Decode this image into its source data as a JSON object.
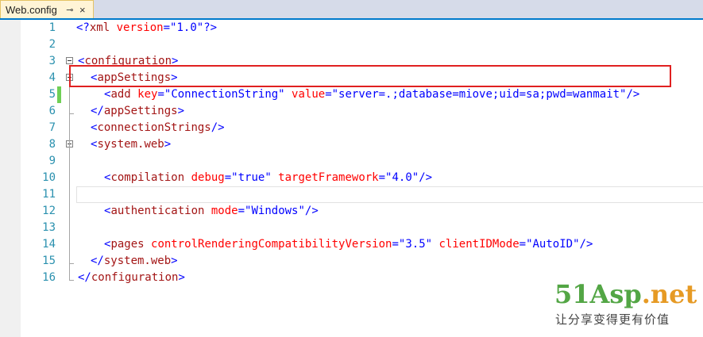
{
  "tab": {
    "title": "Web.config",
    "pin_glyph": "⊸",
    "close_glyph": "×"
  },
  "lines": [
    {
      "num": "1"
    },
    {
      "num": "2"
    },
    {
      "num": "3"
    },
    {
      "num": "4"
    },
    {
      "num": "5"
    },
    {
      "num": "6"
    },
    {
      "num": "7"
    },
    {
      "num": "8"
    },
    {
      "num": "9"
    },
    {
      "num": "10"
    },
    {
      "num": "11"
    },
    {
      "num": "12"
    },
    {
      "num": "13"
    },
    {
      "num": "14"
    },
    {
      "num": "15"
    },
    {
      "num": "16"
    }
  ],
  "code": {
    "l1": {
      "open": "<?",
      "name": "xml",
      "attr": " version",
      "eq": "=",
      "val": "\"1.0\"",
      "close": "?>"
    },
    "l3": {
      "open": "<",
      "name": "configuration",
      "close": ">"
    },
    "l4": {
      "open": "<",
      "name": "appSettings",
      "close": ">"
    },
    "l5": {
      "open": "<",
      "name": "add",
      "a1": " key",
      "eq1": "=",
      "v1": "\"ConnectionString\"",
      "a2": " value",
      "eq2": "=",
      "v2": "\"server=.;database=miove;uid=sa;pwd=wanmait\"",
      "close": "/>"
    },
    "l6": {
      "open": "</",
      "name": "appSettings",
      "close": ">"
    },
    "l7": {
      "open": "<",
      "name": "connectionStrings",
      "close": "/>"
    },
    "l8": {
      "open": "<",
      "name": "system.web",
      "close": ">"
    },
    "l10": {
      "open": "<",
      "name": "compilation",
      "a1": " debug",
      "eq1": "=",
      "v1": "\"true\"",
      "a2": " targetFramework",
      "eq2": "=",
      "v2": "\"4.0\"",
      "close": "/>"
    },
    "l12": {
      "open": "<",
      "name": "authentication",
      "a1": " mode",
      "eq1": "=",
      "v1": "\"Windows\"",
      "close": "/>"
    },
    "l14": {
      "open": "<",
      "name": "pages",
      "a1": " controlRenderingCompatibilityVersion",
      "eq1": "=",
      "v1": "\"3.5\"",
      "a2": " clientIDMode",
      "eq2": "=",
      "v2": "\"AutoID\"",
      "close": "/>"
    },
    "l15": {
      "open": "</",
      "name": "system.web",
      "close": ">"
    },
    "l16": {
      "open": "</",
      "name": "configuration",
      "close": ">"
    }
  },
  "watermark": {
    "logo_a": "51Asp",
    "logo_b": ".net",
    "tagline": "让分享变得更有价值"
  },
  "colors": {
    "tag": "#a31515",
    "bracket": "#0000ff",
    "attr": "#ff0000",
    "value": "#0000ff",
    "line_number": "#2b91af",
    "modified": "#6fcf55",
    "highlight": "#e02020"
  }
}
